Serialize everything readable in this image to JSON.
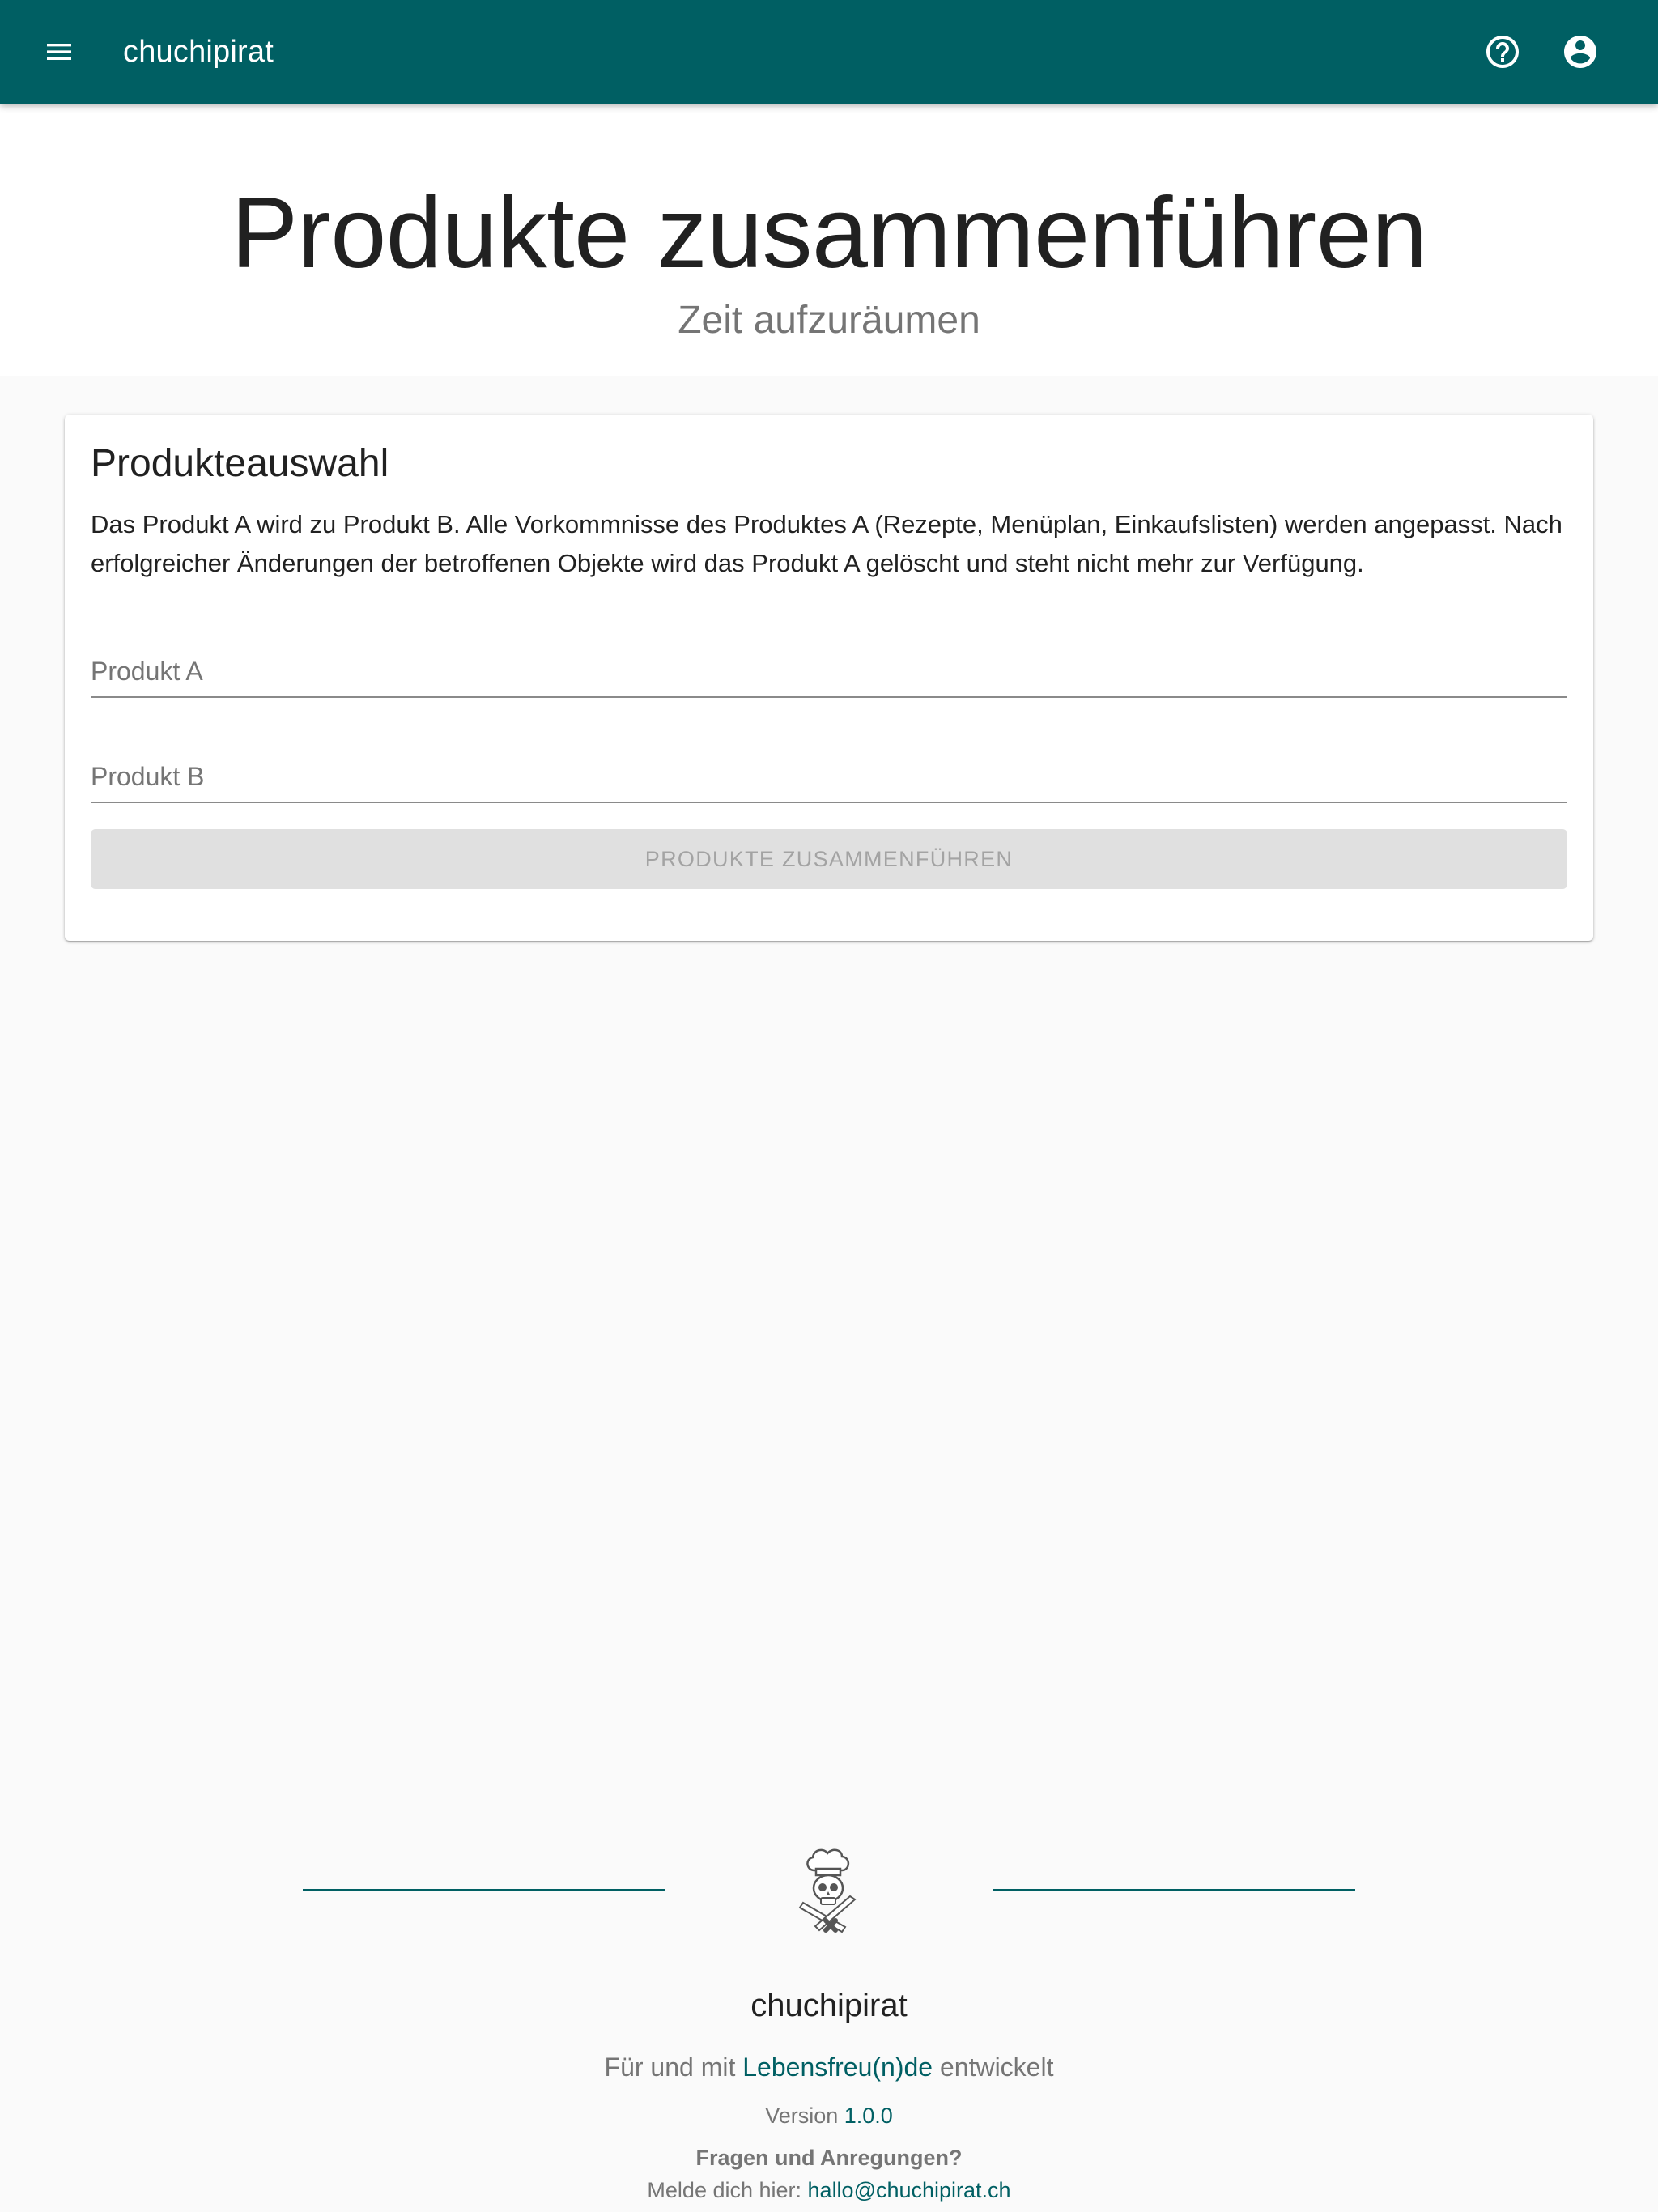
{
  "colors": {
    "primary": "#005f63",
    "background": "#fafafa",
    "surface": "#ffffff",
    "disabled_button": "#e0e0e0",
    "secondary_text": "#757575"
  },
  "appbar": {
    "title": "chuchipirat",
    "menu_icon": "menu-icon",
    "help_icon": "help-circle-icon",
    "account_icon": "account-circle-icon"
  },
  "hero": {
    "title": "Produkte zusammenführen",
    "subtitle": "Zeit aufzuräumen"
  },
  "card": {
    "title": "Produkteauswahl",
    "description": "Das Produkt A wird zu Produkt B. Alle Vorkommnisse des Produktes A (Rezepte, Menüplan, Einkaufslisten) werden angepasst. Nach erfolgreicher Änderungen der betroffenen Objekte wird das Produkt A gelöscht und steht nicht mehr zur Verfügung.",
    "field_a": {
      "label": "Produkt A",
      "value": ""
    },
    "field_b": {
      "label": "Produkt B",
      "value": ""
    },
    "button_label": "PRODUKTE ZUSAMMENFÜHREN"
  },
  "footer": {
    "logo_icon": "pirate-chef-logo-icon",
    "brand": "chuchipirat",
    "tagline_prefix": "Für und mit ",
    "tagline_link": "Lebensfreu(n)de",
    "tagline_suffix": " entwickelt",
    "version_prefix": "Version ",
    "version": "1.0.0",
    "questions": "Fragen und Anregungen?",
    "contact_prefix": "Melde dich hier: ",
    "contact_email": "hallo@chuchipirat.ch"
  }
}
